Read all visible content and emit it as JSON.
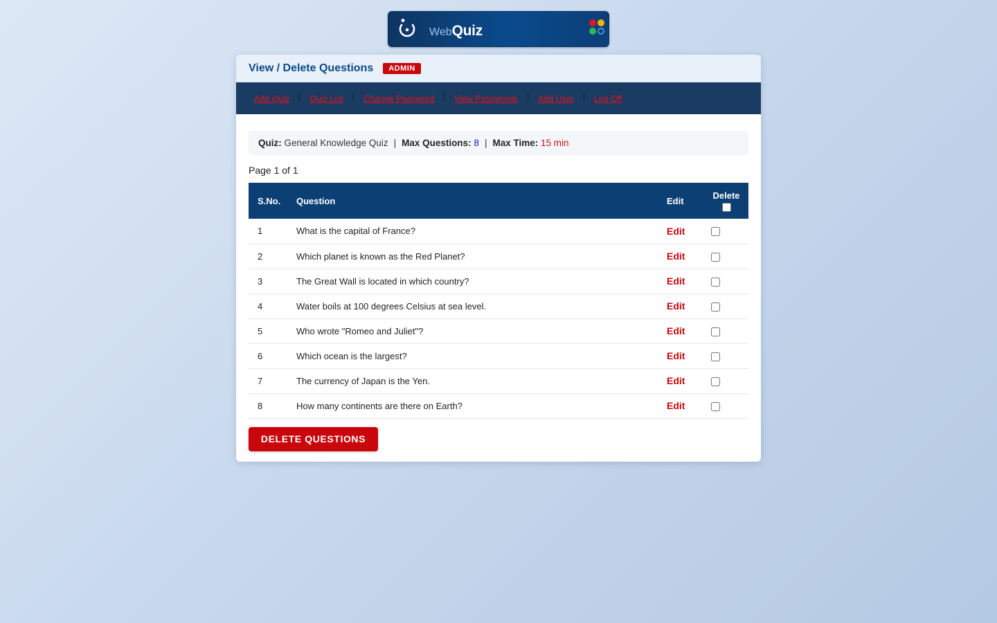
{
  "logo": {
    "prefix": "Web",
    "brand": "Quiz",
    "dot_colors": [
      "#e8121c",
      "#f5b400",
      "#2eb84b",
      "#4a90d9"
    ]
  },
  "header": {
    "title": "View / Delete Questions",
    "badge": "ADMIN"
  },
  "nav": {
    "items": [
      "Add Quiz",
      "Quiz List",
      "Change Password",
      "View Passwords",
      "Add User",
      "Log Off"
    ]
  },
  "quiz_info": {
    "quiz_label": "Quiz:",
    "quiz_name": "General Knowledge Quiz",
    "max_questions_label": "Max Questions:",
    "max_questions": "8",
    "max_time_label": "Max Time:",
    "max_time": "15 min",
    "separator": "|"
  },
  "pagination": {
    "text": "Page 1 of 1"
  },
  "table": {
    "headers": {
      "sno": "S.No.",
      "question": "Question",
      "edit": "Edit",
      "delete": "Delete"
    },
    "edit_label": "Edit",
    "rows": [
      {
        "sno": "1",
        "question": "What is the capital of France?"
      },
      {
        "sno": "2",
        "question": "Which planet is known as the Red Planet?"
      },
      {
        "sno": "3",
        "question": "The Great Wall is located in which country?"
      },
      {
        "sno": "4",
        "question": "Water boils at 100 degrees Celsius at sea level."
      },
      {
        "sno": "5",
        "question": "Who wrote \"Romeo and Juliet\"?"
      },
      {
        "sno": "6",
        "question": "Which ocean is the largest?"
      },
      {
        "sno": "7",
        "question": "The currency of Japan is the Yen."
      },
      {
        "sno": "8",
        "question": "How many continents are there on Earth?"
      }
    ]
  },
  "actions": {
    "delete_button": "DELETE QUESTIONS"
  }
}
